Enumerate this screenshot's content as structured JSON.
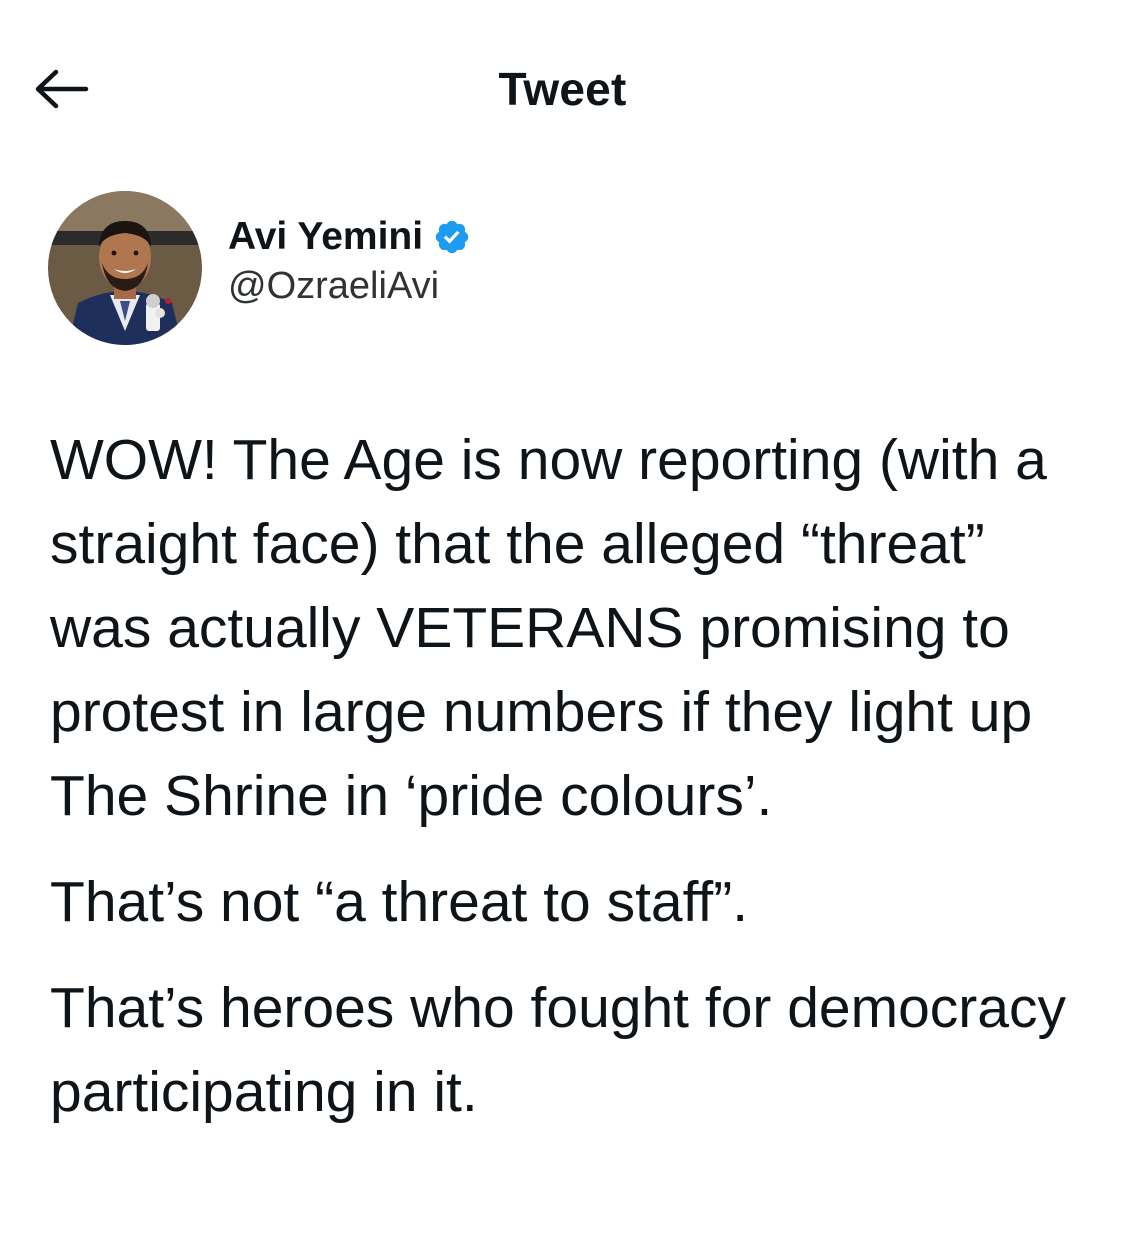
{
  "header": {
    "title": "Tweet",
    "back_icon": "arrow-left-icon"
  },
  "author": {
    "name": "Avi Yemini",
    "handle": "@OzraeliAvi",
    "verified_icon": "verified-badge-icon",
    "verified_color": "#1d9bf0"
  },
  "tweet": {
    "paragraphs": [
      "WOW! The Age is now reporting (with a straight face) that the alleged “threat” was actually VETERANS promising to protest in large numbers if they light up The Shrine in ‘pride colours’.",
      "That’s not “a threat to staff”.",
      "That’s heroes who fought for democracy participating in it."
    ]
  },
  "colors": {
    "text": "#0f1419",
    "secondary_text": "#2f3336",
    "accent": "#1d9bf0"
  }
}
